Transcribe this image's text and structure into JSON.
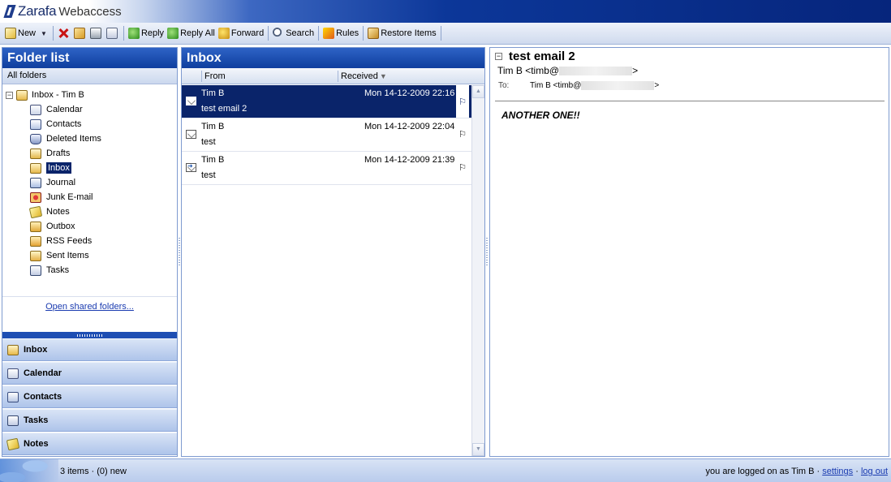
{
  "app": {
    "brand": "Zarafa",
    "brand_sub": "Webaccess"
  },
  "toolbar": {
    "new_label": "New",
    "reply_label": "Reply",
    "reply_all_label": "Reply All",
    "forward_label": "Forward",
    "search_label": "Search",
    "rules_label": "Rules",
    "restore_label": "Restore Items"
  },
  "folder_panel": {
    "title": "Folder list",
    "all_folders": "All folders",
    "root_label": "Inbox - Tim B",
    "folders": [
      {
        "label": "Calendar",
        "icon": "calendar-icon"
      },
      {
        "label": "Contacts",
        "icon": "contacts-icon"
      },
      {
        "label": "Deleted Items",
        "icon": "trash-icon"
      },
      {
        "label": "Drafts",
        "icon": "drafts-icon"
      },
      {
        "label": "Inbox",
        "icon": "inbox-icon"
      },
      {
        "label": "Journal",
        "icon": "journal-icon"
      },
      {
        "label": "Junk E-mail",
        "icon": "junk-icon"
      },
      {
        "label": "Notes",
        "icon": "notes-icon"
      },
      {
        "label": "Outbox",
        "icon": "outbox-icon"
      },
      {
        "label": "RSS Feeds",
        "icon": "rss-icon"
      },
      {
        "label": "Sent Items",
        "icon": "sent-icon"
      },
      {
        "label": "Tasks",
        "icon": "tasks-icon"
      }
    ],
    "selected_folder": "Inbox",
    "open_shared": "Open shared folders...",
    "shortcuts": [
      {
        "label": "Inbox",
        "icon": "inbox-icon"
      },
      {
        "label": "Calendar",
        "icon": "calendar-icon"
      },
      {
        "label": "Contacts",
        "icon": "contacts-icon"
      },
      {
        "label": "Tasks",
        "icon": "tasks-icon"
      },
      {
        "label": "Notes",
        "icon": "notes-icon"
      }
    ]
  },
  "inbox": {
    "title": "Inbox",
    "col_from": "From",
    "col_received": "Received",
    "messages": [
      {
        "from": "Tim B",
        "received": "Mon 14-12-2009 22:16",
        "subject": "test email 2",
        "selected": true
      },
      {
        "from": "Tim B",
        "received": "Mon 14-12-2009 22:04",
        "subject": "test",
        "selected": false
      },
      {
        "from": "Tim B",
        "received": "Mon 14-12-2009 21:39",
        "subject": "test",
        "selected": false
      }
    ]
  },
  "reading_pane": {
    "subject": "test email 2",
    "from_prefix": "Tim B <timb@",
    "from_suffix": ">",
    "to_label": "To:",
    "to_prefix": "Tim B <timb@",
    "to_suffix": ">",
    "body": "ANOTHER ONE!!"
  },
  "status": {
    "items": "3 items · (0) new",
    "logged_on": "you are logged on as Tim B ·",
    "settings": "settings",
    "sep": "·",
    "logout": "log out"
  },
  "colors": {
    "header_blue": "#1a4fb5",
    "selection": "#0a246a",
    "link": "#1a3bb0"
  }
}
